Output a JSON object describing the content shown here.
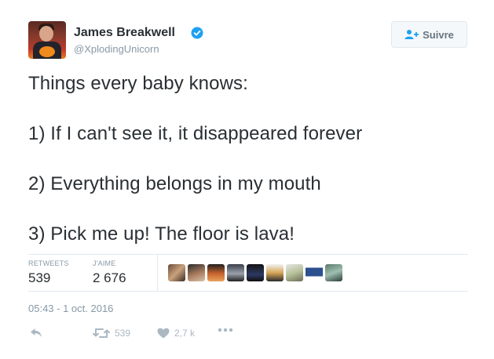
{
  "author": {
    "name": "James Breakwell",
    "handle": "@XplodingUnicorn",
    "verified": true
  },
  "follow_button": {
    "label": "Suivre",
    "icon": "add-user-icon"
  },
  "tweet": {
    "lines": [
      "Things every baby knows:",
      "1) If I can't see it, it disappeared forever",
      "2) Everything belongs in my mouth",
      "3) Pick me up! The floor is lava!"
    ]
  },
  "stats": {
    "retweets_label": "RETWEETS",
    "retweets_value": "539",
    "likes_label": "J'AIME",
    "likes_value": "2 676"
  },
  "liker_avatars": [
    {
      "icon": "liker-avatar-1"
    },
    {
      "icon": "liker-avatar-2"
    },
    {
      "icon": "liker-avatar-3"
    },
    {
      "icon": "liker-avatar-4"
    },
    {
      "icon": "liker-avatar-5"
    },
    {
      "icon": "liker-avatar-6"
    },
    {
      "icon": "liker-avatar-7"
    },
    {
      "icon": "liker-avatar-8"
    },
    {
      "icon": "liker-avatar-9"
    }
  ],
  "timestamp": "05:43 - 1 oct. 2016",
  "actions": {
    "reply_icon": "reply-icon",
    "retweet_icon": "retweet-icon",
    "retweet_count": "539",
    "like_icon": "heart-icon",
    "like_count": "2,7 k",
    "more_icon": "more-icon"
  },
  "colors": {
    "verified": "#1da1f2",
    "text": "#292f33",
    "muted": "#8899a6",
    "action": "#aab8c2",
    "border": "#e1e8ed"
  }
}
